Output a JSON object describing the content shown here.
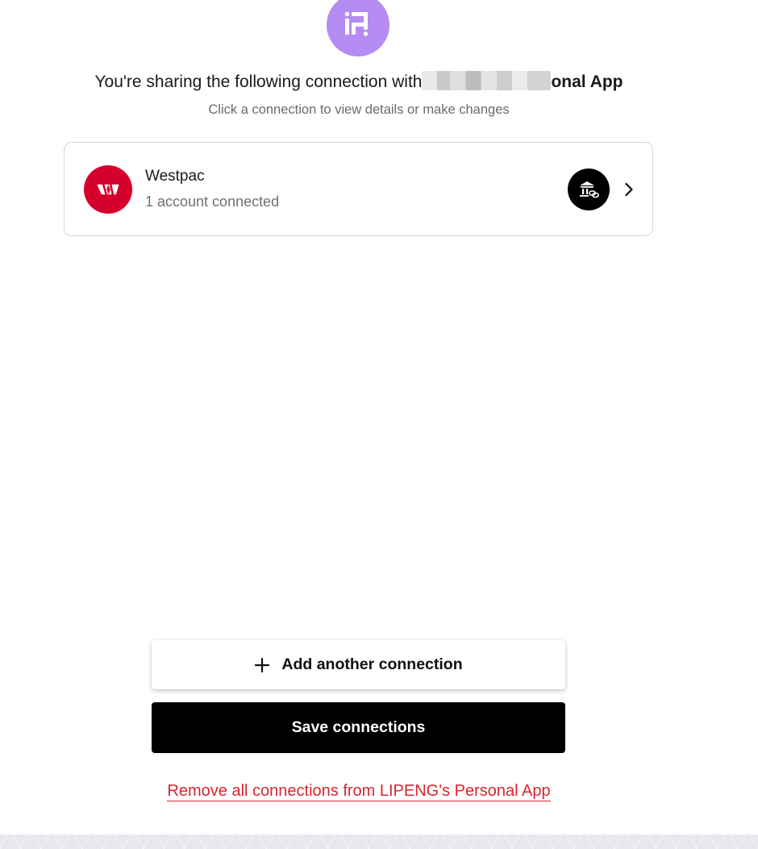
{
  "header": {
    "logo_icon": "app-logo-icon",
    "logo_color": "#b48cf2",
    "title_prefix": "You're sharing the following connection with",
    "title_app_name_visible": "onal App",
    "subtitle": "Click a connection to view details or make changes"
  },
  "connections": [
    {
      "bank_name": "Westpac",
      "status": "1 account connected",
      "logo_icon": "westpac-logo",
      "logo_color": "#d5002b",
      "type_icon": "bank-link-icon",
      "chevron_icon": "chevron-right-icon"
    }
  ],
  "actions": {
    "add_label": "Add another connection",
    "add_icon": "plus-icon",
    "save_label": "Save connections",
    "remove_label": "Remove all connections from LIPENG's Personal App",
    "remove_color": "#d9242f"
  }
}
